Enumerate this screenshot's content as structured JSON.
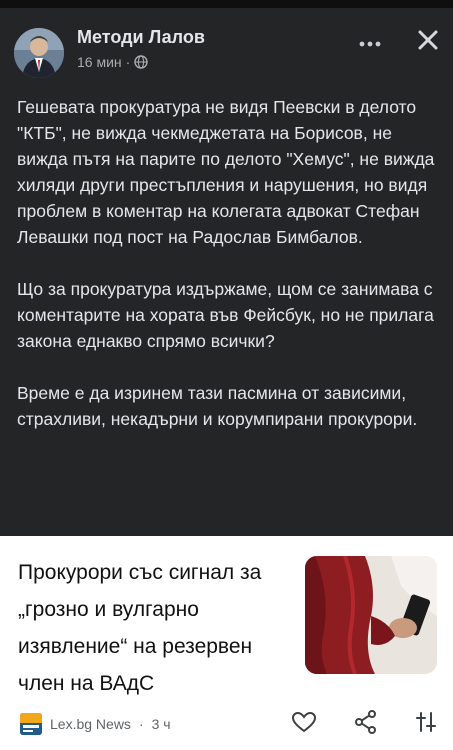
{
  "post": {
    "author": "Методи Лалов",
    "time": "16 мин",
    "separator": "·",
    "paragraphs": [
      "Гешевата прокуратура не видя Пеевски в делото \"КТБ\", не вижда чекмеджетата на Борисов, не вижда пътя на парите по делото \"Хемус\", не вижда хиляди други престъпления и нарушения, но видя проблем в коментар на колегата адвокат Стефан Левашки под пост на Радослав Бимбалов.",
      "Що за прокуратура издържаме, щом се занимава с коментарите на хората във Фейсбук, но не прилага закона еднакво спрямо всички?",
      "Време е да изринем тази пасмина от зависими, страхливи, некадърни и корумпирани прокурори."
    ],
    "icons": [
      "globe-icon",
      "more-icon",
      "close-icon"
    ]
  },
  "link_card": {
    "title": "Прокурори със сигнал за „грозно и вулгарно изявление“ на резервен член на ВАдС",
    "source_name": "Lex.bg News",
    "time": "3 ч",
    "separator": "·",
    "icons": [
      "heart-icon",
      "share-icon",
      "sort-icon"
    ]
  },
  "colors": {
    "post_bg": "#242526",
    "text": "#e4e6eb",
    "meta": "#a8abb0",
    "card_bg": "#ffffff",
    "card_text": "#111111",
    "card_meta": "#5f6368"
  }
}
